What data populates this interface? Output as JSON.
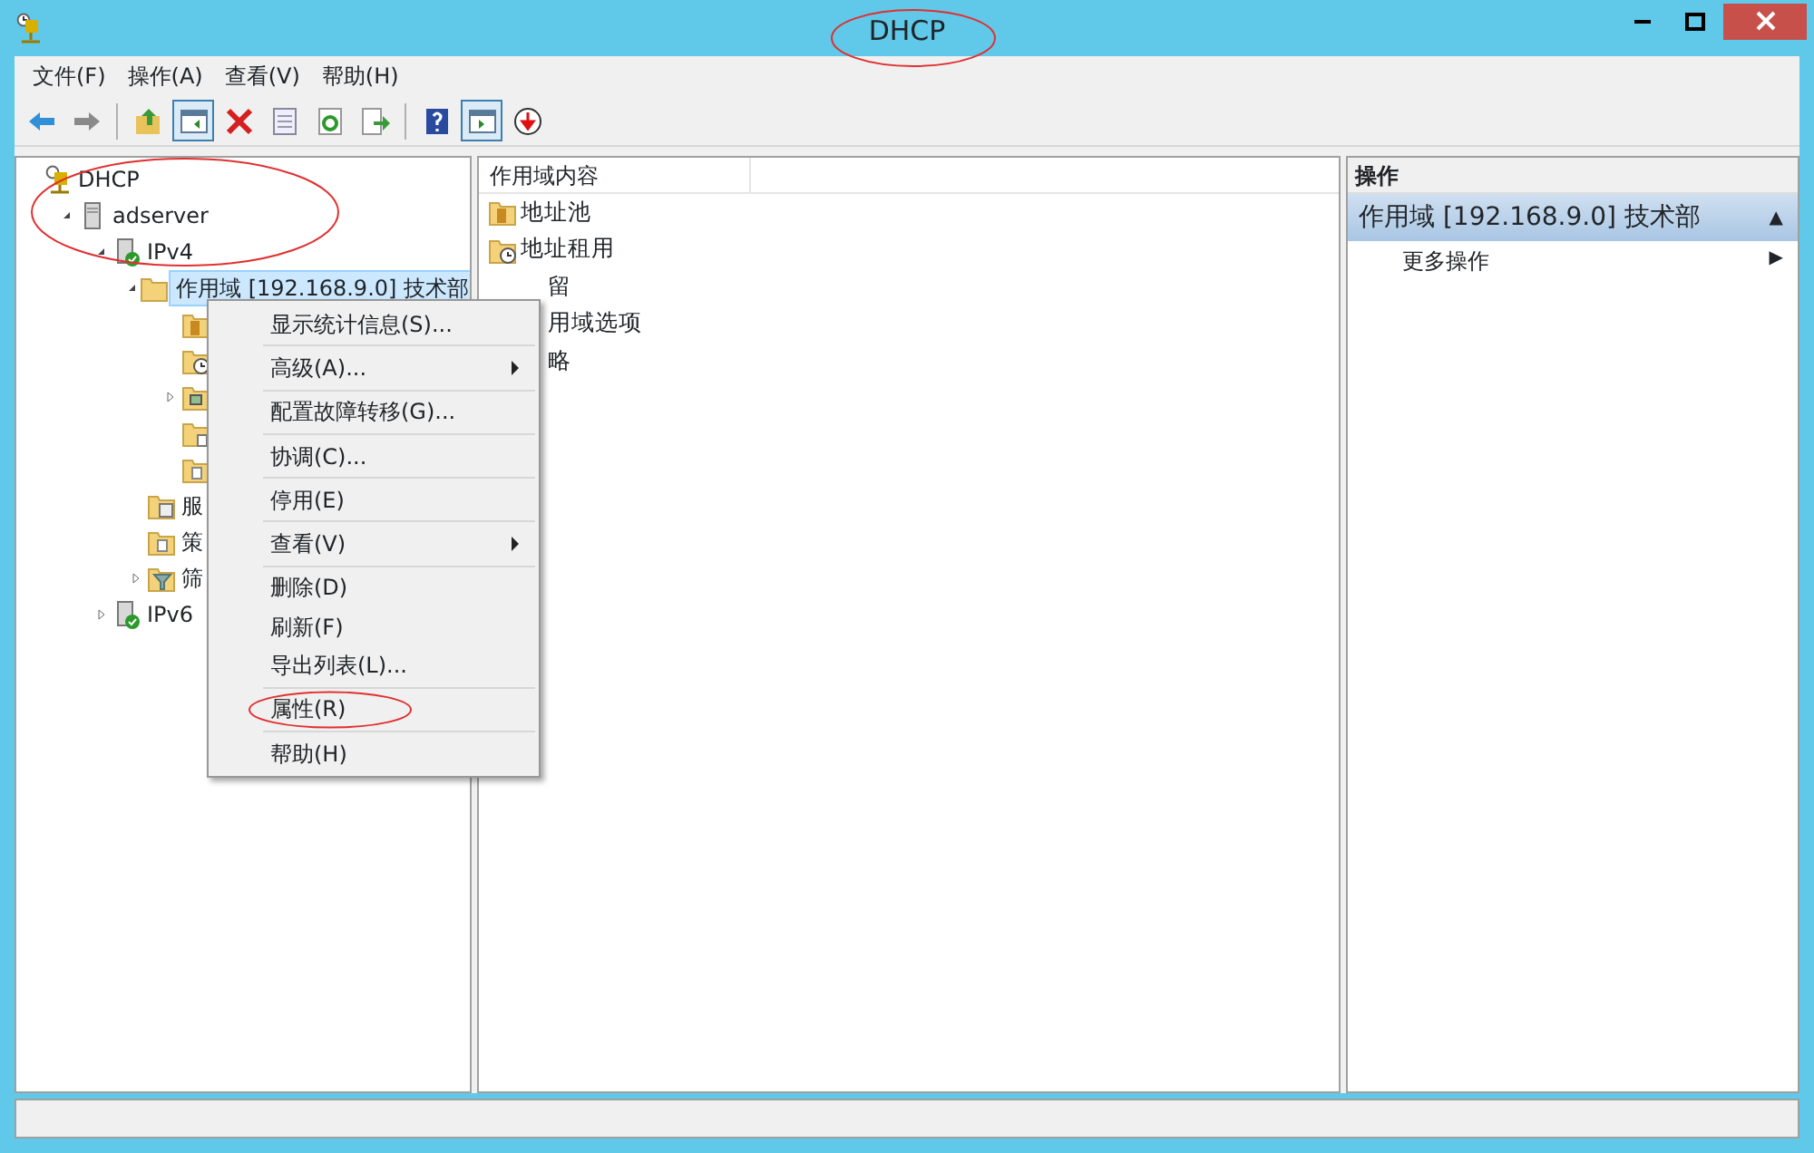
{
  "window": {
    "title": "DHCP"
  },
  "menu_bar": [
    "文件(F)",
    "操作(A)",
    "查看(V)",
    "帮助(H)"
  ],
  "toolbar": [
    {
      "kind": "back",
      "pressed": false
    },
    {
      "kind": "forward",
      "pressed": false
    },
    {
      "kind": "separator"
    },
    {
      "kind": "up",
      "pressed": false
    },
    {
      "kind": "tree",
      "pressed": true
    },
    {
      "kind": "delete",
      "pressed": false
    },
    {
      "kind": "properties",
      "pressed": false
    },
    {
      "kind": "refresh",
      "pressed": false
    },
    {
      "kind": "export",
      "pressed": false
    },
    {
      "kind": "separator"
    },
    {
      "kind": "help",
      "pressed": false
    },
    {
      "kind": "pane",
      "pressed": true
    },
    {
      "kind": "down",
      "pressed": false
    }
  ],
  "tree": [
    {
      "kind": "root",
      "label": "DHCP",
      "selected": false,
      "children": [
        {
          "kind": "server",
          "label": "adserver",
          "expanded": true,
          "selected": false,
          "children": [
            {
              "kind": "ipv",
              "label": "IPv4",
              "expanded": true,
              "selected": false,
              "children": [
                {
                  "kind": "folder",
                  "label": "作用域 [192.168.9.0] 技术部",
                  "expanded": true,
                  "selected": true,
                  "children": [
                    {
                      "kind": "pool",
                      "selected": false
                    },
                    {
                      "kind": "lease",
                      "selected": false
                    },
                    {
                      "kind": "reserve",
                      "expanded": false,
                      "selected": false
                    },
                    {
                      "kind": "options",
                      "selected": false
                    },
                    {
                      "kind": "policy",
                      "selected": false
                    }
                  ]
                },
                {
                  "kind": "service",
                  "label": "服",
                  "selected": false
                },
                {
                  "kind": "policy",
                  "label": "策",
                  "selected": false
                },
                {
                  "kind": "filter",
                  "label": "筛",
                  "expanded": false,
                  "selected": false
                }
              ]
            },
            {
              "kind": "ipv",
              "label": "IPv6",
              "expanded": false,
              "selected": false
            }
          ]
        }
      ]
    }
  ],
  "content": {
    "column": "作用域内容",
    "items": [
      {
        "kind": "pool",
        "label": "地址池"
      },
      {
        "kind": "lease",
        "label": "地址租用"
      },
      {
        "kind": "hidden",
        "label": "留"
      },
      {
        "kind": "hidden",
        "label": "用域选项"
      },
      {
        "kind": "hidden",
        "label": "略"
      }
    ]
  },
  "actions": {
    "header": "操作",
    "section": "作用域 [192.168.9.0] 技术部",
    "section_toggle": "▲",
    "items": [
      {
        "label": "更多操作",
        "arrow": "▶"
      }
    ]
  },
  "context_menu": [
    {
      "kind": "item",
      "label": "显示统计信息(S)...",
      "submenu": false
    },
    {
      "kind": "separator"
    },
    {
      "kind": "item",
      "label": "高级(A)...",
      "submenu": true
    },
    {
      "kind": "separator"
    },
    {
      "kind": "item",
      "label": "配置故障转移(G)...",
      "submenu": false
    },
    {
      "kind": "separator"
    },
    {
      "kind": "item",
      "label": "协调(C)...",
      "submenu": false
    },
    {
      "kind": "separator"
    },
    {
      "kind": "item",
      "label": "停用(E)",
      "submenu": false
    },
    {
      "kind": "separator"
    },
    {
      "kind": "item",
      "label": "查看(V)",
      "submenu": true
    },
    {
      "kind": "separator"
    },
    {
      "kind": "item",
      "label": "删除(D)",
      "submenu": false
    },
    {
      "kind": "item",
      "label": "刷新(F)",
      "submenu": false
    },
    {
      "kind": "item",
      "label": "导出列表(L)...",
      "submenu": false
    },
    {
      "kind": "separator"
    },
    {
      "kind": "item",
      "label": "属性(R)",
      "submenu": false
    },
    {
      "kind": "separator"
    },
    {
      "kind": "item",
      "label": "帮助(H)",
      "submenu": false
    }
  ]
}
